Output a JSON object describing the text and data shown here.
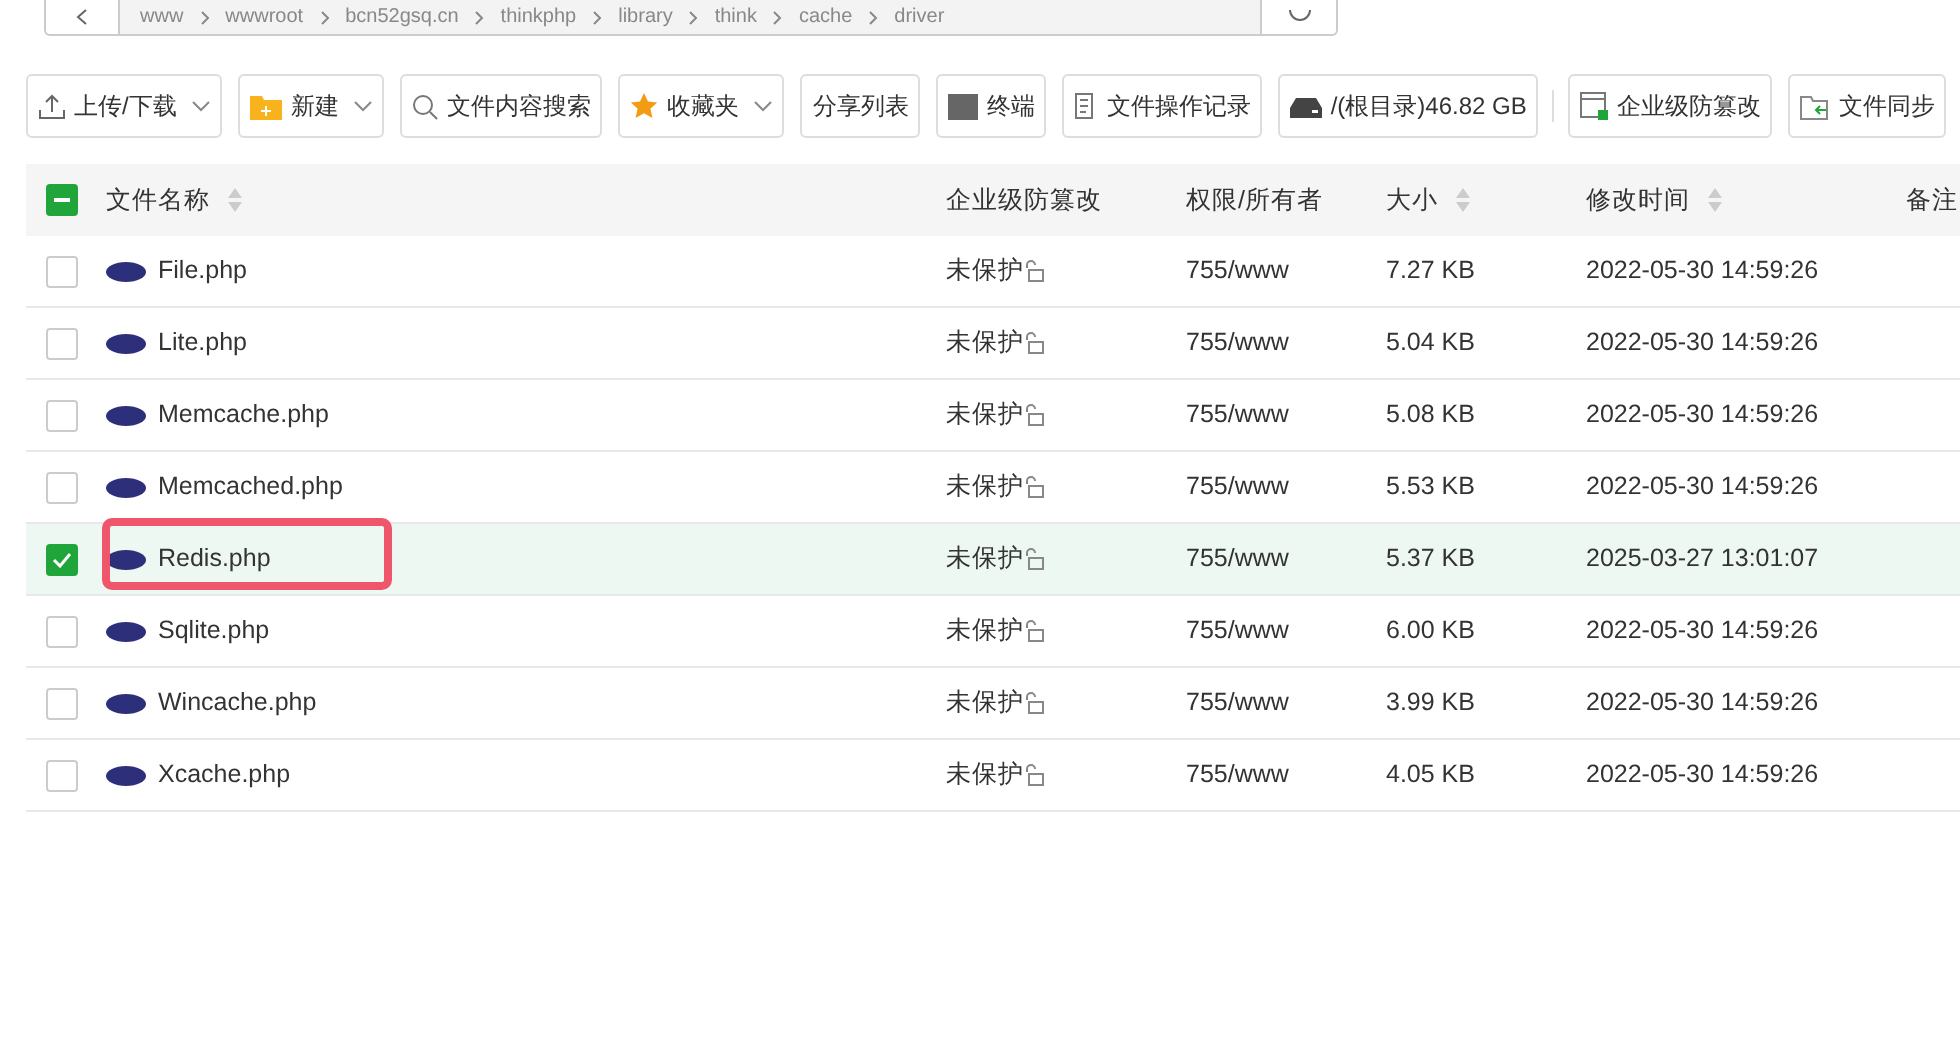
{
  "breadcrumb": [
    "www",
    "wwwroot",
    "bcn52gsq.cn",
    "thinkphp",
    "library",
    "think",
    "cache",
    "driver"
  ],
  "toolbar": [
    {
      "label": "上传/下载",
      "dropdown": true,
      "separator_before": false
    },
    {
      "label": "新建",
      "dropdown": true,
      "separator_before": false
    },
    {
      "label": "文件内容搜索",
      "dropdown": false,
      "separator_before": false
    },
    {
      "label": "收藏夹",
      "dropdown": true,
      "separator_before": false
    },
    {
      "label": "分享列表",
      "dropdown": false,
      "separator_before": false
    },
    {
      "label": "终端",
      "dropdown": false,
      "separator_before": false
    },
    {
      "label": "文件操作记录",
      "dropdown": false,
      "separator_before": false
    },
    {
      "label": "/(根目录)46.82 GB",
      "dropdown": false,
      "separator_before": false
    },
    {
      "label": "企业级防篡改",
      "dropdown": false,
      "separator_before": true
    },
    {
      "label": "文件同步",
      "dropdown": false,
      "separator_before": false
    }
  ],
  "table": {
    "select_all": {
      "indeterminate": true
    },
    "columns": [
      {
        "label": "文件名称",
        "sortable": true
      },
      {
        "label": "企业级防篡改",
        "sortable": false
      },
      {
        "label": "权限/所有者",
        "sortable": false
      },
      {
        "label": "大小",
        "sortable": true
      },
      {
        "label": "修改时间",
        "sortable": true
      },
      {
        "label": "备注",
        "sortable": false
      }
    ],
    "rows": [
      {
        "name": "File.php",
        "protect": "未保护",
        "perm": "755/www",
        "size": "7.27 KB",
        "mtime": "2022-05-30 14:59:26",
        "selected": false,
        "highlighted": false
      },
      {
        "name": "Lite.php",
        "protect": "未保护",
        "perm": "755/www",
        "size": "5.04 KB",
        "mtime": "2022-05-30 14:59:26",
        "selected": false,
        "highlighted": false
      },
      {
        "name": "Memcache.php",
        "protect": "未保护",
        "perm": "755/www",
        "size": "5.08 KB",
        "mtime": "2022-05-30 14:59:26",
        "selected": false,
        "highlighted": false
      },
      {
        "name": "Memcached.php",
        "protect": "未保护",
        "perm": "755/www",
        "size": "5.53 KB",
        "mtime": "2022-05-30 14:59:26",
        "selected": false,
        "highlighted": false
      },
      {
        "name": "Redis.php",
        "protect": "未保护",
        "perm": "755/www",
        "size": "5.37 KB",
        "mtime": "2025-03-27 13:01:07",
        "selected": true,
        "highlighted": true
      },
      {
        "name": "Sqlite.php",
        "protect": "未保护",
        "perm": "755/www",
        "size": "6.00 KB",
        "mtime": "2022-05-30 14:59:26",
        "selected": false,
        "highlighted": false
      },
      {
        "name": "Wincache.php",
        "protect": "未保护",
        "perm": "755/www",
        "size": "3.99 KB",
        "mtime": "2022-05-30 14:59:26",
        "selected": false,
        "highlighted": false
      },
      {
        "name": "Xcache.php",
        "protect": "未保护",
        "perm": "755/www",
        "size": "4.05 KB",
        "mtime": "2022-05-30 14:59:26",
        "selected": false,
        "highlighted": false
      }
    ]
  }
}
